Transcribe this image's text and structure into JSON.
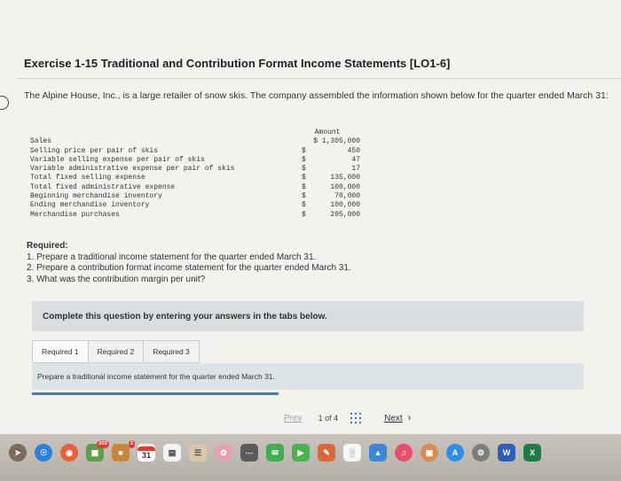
{
  "exercise": {
    "title": "Exercise 1-15 Traditional and Contribution Format Income Statements [LO1-6]",
    "intro": "The Alpine House, Inc., is a large retailer of snow skis. The company assembled the information shown below for the quarter ended March 31:"
  },
  "table": {
    "amount_header": "Amount",
    "rows": [
      {
        "label": "Sales",
        "currency": "",
        "amount": "$ 1,305,000"
      },
      {
        "label": "Selling price per pair of skis",
        "currency": "$",
        "amount": "450"
      },
      {
        "label": "Variable selling expense per pair of skis",
        "currency": "$",
        "amount": "47"
      },
      {
        "label": "Variable administrative expense per pair of skis",
        "currency": "$",
        "amount": "17"
      },
      {
        "label": "Total fixed selling expense",
        "currency": "$",
        "amount": "135,000"
      },
      {
        "label": "Total fixed administrative expense",
        "currency": "$",
        "amount": "100,000"
      },
      {
        "label": "Beginning merchandise inventory",
        "currency": "$",
        "amount": "70,000"
      },
      {
        "label": "Ending merchandise inventory",
        "currency": "$",
        "amount": "100,000"
      },
      {
        "label": "Merchandise purchases",
        "currency": "$",
        "amount": "295,000"
      }
    ]
  },
  "required": {
    "header": "Required:",
    "items": [
      "1. Prepare a traditional income statement for the quarter ended March 31.",
      "2. Prepare a contribution format income statement for the quarter ended March 31.",
      "3. What was the contribution margin per unit?"
    ]
  },
  "banner": "Complete this question by entering your answers in the tabs below.",
  "tabs": [
    "Required 1",
    "Required 2",
    "Required 3"
  ],
  "tab_content": "Prepare a traditional income statement for the quarter ended March 31.",
  "pager": {
    "prev": "Prev",
    "count": "1 of 4",
    "next": "Next"
  },
  "dock": {
    "badge_photos": "203",
    "badge_calendar": "3",
    "calendar_day": "31",
    "word_label": "W",
    "excel_label": "X"
  },
  "colors": {
    "accent": "#3f80c0",
    "banner": "#d9dde0",
    "tab_panel": "#dde4e7"
  }
}
